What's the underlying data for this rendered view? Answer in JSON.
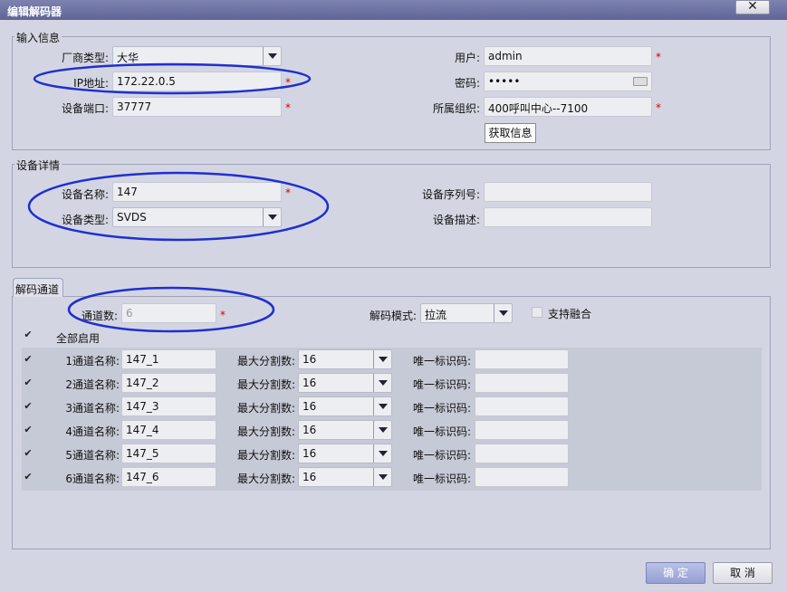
{
  "window": {
    "title": "编辑解码器",
    "close_label": "✕"
  },
  "input_info": {
    "legend": "输入信息",
    "vendor_label": "厂商类型:",
    "vendor_value": "大华",
    "ip_label": "IP地址:",
    "ip_value": "172.22.0.5",
    "port_label": "设备端口:",
    "port_value": "37777",
    "user_label": "用户:",
    "user_value": "admin",
    "password_label": "密码:",
    "password_value": "•••••",
    "org_label": "所属组织:",
    "org_value": "400呼叫中心--7100",
    "fetch_button": "获取信息",
    "required_mark": "*"
  },
  "device_detail": {
    "legend": "设备详情",
    "name_label": "设备名称:",
    "name_value": "147",
    "type_label": "设备类型:",
    "type_value": "SVDS",
    "serial_label": "设备序列号:",
    "serial_value": "",
    "desc_label": "设备描述:",
    "desc_value": ""
  },
  "decode_channel": {
    "tab_label": "解码通道",
    "count_label": "通道数:",
    "count_value": "6",
    "mode_label": "解码模式:",
    "mode_value": "拉流",
    "fusion_label": "支持融合",
    "enable_all_label": "全部启用",
    "rows": [
      {
        "index_label": "1通道名称:",
        "name": "147_1",
        "split_label": "最大分割数:",
        "split": "16",
        "uid_label": "唯一标识码:",
        "uid": ""
      },
      {
        "index_label": "2通道名称:",
        "name": "147_2",
        "split_label": "最大分割数:",
        "split": "16",
        "uid_label": "唯一标识码:",
        "uid": ""
      },
      {
        "index_label": "3通道名称:",
        "name": "147_3",
        "split_label": "最大分割数:",
        "split": "16",
        "uid_label": "唯一标识码:",
        "uid": ""
      },
      {
        "index_label": "4通道名称:",
        "name": "147_4",
        "split_label": "最大分割数:",
        "split": "16",
        "uid_label": "唯一标识码:",
        "uid": ""
      },
      {
        "index_label": "5通道名称:",
        "name": "147_5",
        "split_label": "最大分割数:",
        "split": "16",
        "uid_label": "唯一标识码:",
        "uid": ""
      },
      {
        "index_label": "6通道名称:",
        "name": "147_6",
        "split_label": "最大分割数:",
        "split": "16",
        "uid_label": "唯一标识码:",
        "uid": ""
      }
    ]
  },
  "footer": {
    "confirm_label": "确 定",
    "cancel_label": "取 消"
  },
  "colors": {
    "annotation": "#1f2fd0",
    "required": "#dd0000",
    "titlebar": "#6a6fa3"
  }
}
